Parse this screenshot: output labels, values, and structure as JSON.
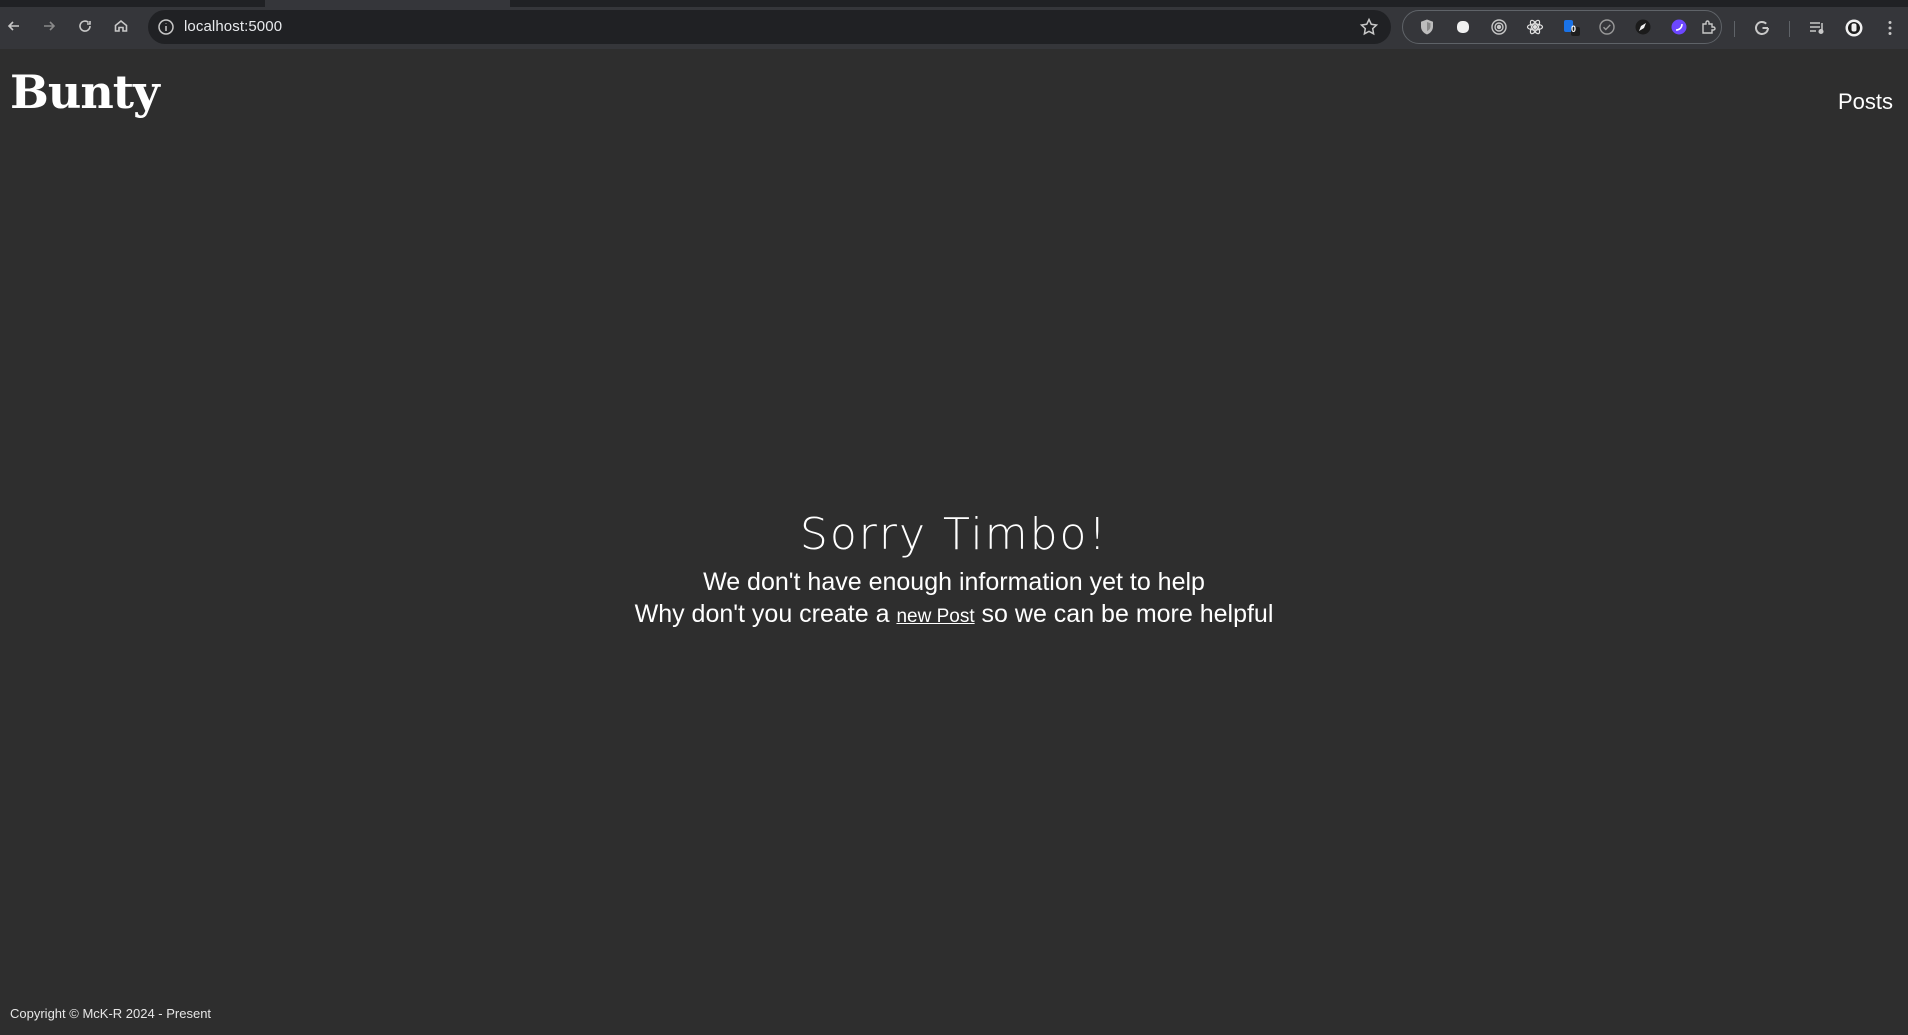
{
  "browser": {
    "url": "localhost:5000",
    "extensions": [
      "shield-icon",
      "ghost-icon",
      "target-icon",
      "atom-icon",
      "badge-extension-icon",
      "check-circle-icon",
      "pen-extension-icon",
      "purple-circle-extension-icon",
      "puzzle-icon"
    ],
    "extension_badge": "0",
    "colors": {
      "toolbar": "#35363a",
      "omnibox": "#202124"
    }
  },
  "site": {
    "logo": "Bunty",
    "nav_posts": "Posts",
    "background": "#2e2e2e"
  },
  "message": {
    "title": "Sorry Timbo!",
    "line1": "We don't have enough information yet to help",
    "line2_before": "Why don't you create a ",
    "line2_link": "new Post",
    "line2_after": " so we can be more helpful"
  },
  "footer": {
    "text": "Copyright © McK-R 2024 - Present"
  }
}
